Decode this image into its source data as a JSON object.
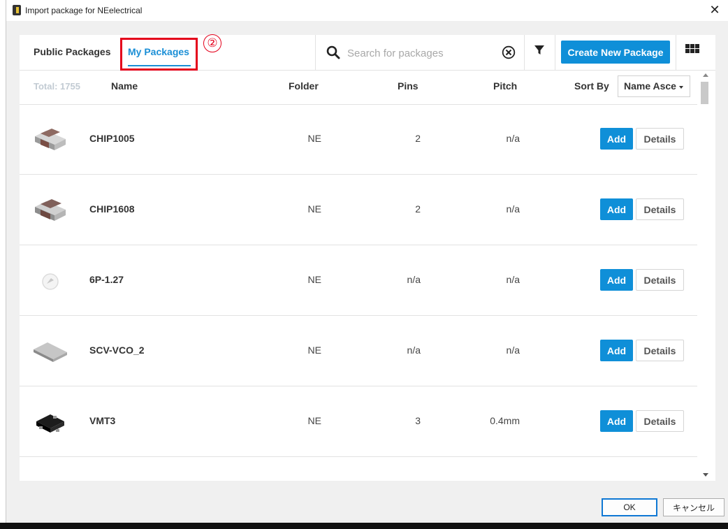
{
  "window": {
    "title": "Import package for NEelectrical",
    "close_label": "✕"
  },
  "tabs": {
    "public": "Public Packages",
    "my": "My Packages",
    "active": "my"
  },
  "annotation": {
    "number": "②"
  },
  "search": {
    "placeholder": "Search for packages",
    "value": ""
  },
  "toolbar": {
    "create_label": "Create New Package"
  },
  "table": {
    "total": "Total: 1755",
    "headers": {
      "name": "Name",
      "folder": "Folder",
      "pins": "Pins",
      "pitch": "Pitch"
    },
    "sort_label": "Sort By",
    "sort_value": "Name Asce",
    "rows": [
      {
        "name": "CHIP1005",
        "folder": "NE",
        "pins": "2",
        "pitch": "n/a",
        "icon": "chip-resistor-icon"
      },
      {
        "name": "CHIP1608",
        "folder": "NE",
        "pins": "2",
        "pitch": "n/a",
        "icon": "chip-resistor-icon"
      },
      {
        "name": "6P-1.27",
        "folder": "NE",
        "pins": "n/a",
        "pitch": "n/a",
        "icon": "placeholder-package-icon"
      },
      {
        "name": "SCV-VCO_2",
        "folder": "NE",
        "pins": "n/a",
        "pitch": "n/a",
        "icon": "flat-module-icon"
      },
      {
        "name": "VMT3",
        "folder": "NE",
        "pins": "3",
        "pitch": "0.4mm",
        "icon": "sot-package-icon"
      }
    ],
    "add_label": "Add",
    "details_label": "Details"
  },
  "footer": {
    "ok_label": "OK",
    "cancel_label": "キャンセル"
  },
  "colors": {
    "accent": "#0f8fd8",
    "annotation": "#e4001b"
  }
}
